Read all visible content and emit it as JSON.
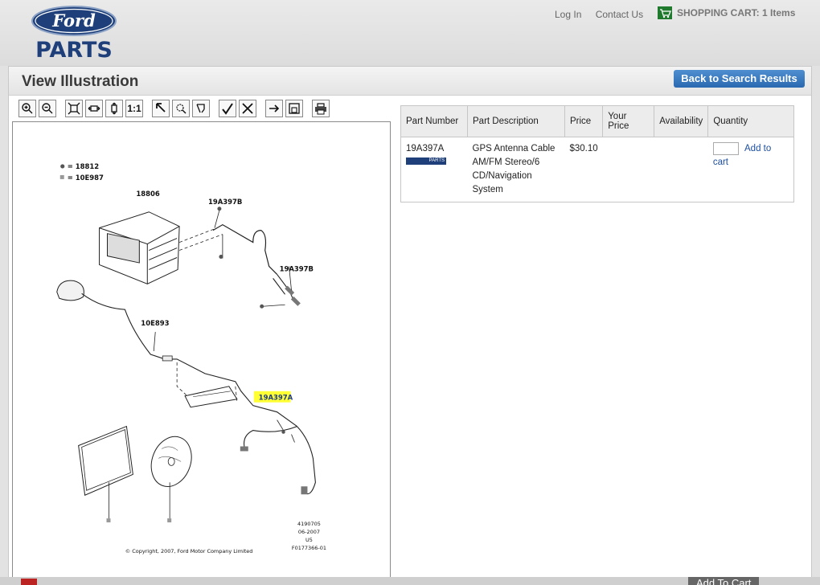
{
  "header": {
    "brand_word": "Ford",
    "parts_word": "PARTS",
    "login": "Log In",
    "contact": "Contact Us",
    "cart": "SHOPPING CART: 1 Items"
  },
  "page": {
    "title": "View Illustration",
    "back_button": "Back to Search Results"
  },
  "toolbar": {
    "buttons": [
      "zoom-in-icon",
      "zoom-out-icon",
      "fit-icon",
      "fit-width-icon",
      "fit-height-icon",
      "actual-size",
      "select-arrow-icon",
      "zoom-box-icon",
      "pan-icon",
      "check-icon",
      "clear-icon",
      "arrow-icon",
      "window-icon",
      "print-icon"
    ],
    "actual_size_label": "1:1"
  },
  "illustration": {
    "legend_dot": "= 18812",
    "legend_square": "= 10E987",
    "labels": [
      "18806",
      "19A397B",
      "19A397B",
      "10E893",
      "19A397A"
    ],
    "highlighted": "19A397A",
    "ref_lines": [
      "4190705",
      "06-2007",
      "U5",
      "F0177366-01"
    ],
    "copyright": "© Copyright, 2007, Ford Motor Company Limited"
  },
  "table": {
    "headers": [
      "Part Number",
      "Part Description",
      "Price",
      "Your Price",
      "Availability",
      "Quantity"
    ],
    "rows": [
      {
        "part_number": "19A397A",
        "badge": "PARTS",
        "desc_lines": [
          "GPS Antenna Cable",
          "AM/FM Stereo/6",
          "CD/Navigation System"
        ],
        "price": "$30.10",
        "your_price": "",
        "availability": "",
        "quantity": "",
        "add_label": "Add to cart"
      }
    ]
  },
  "footer": {
    "add_to_cart": "Add To Cart"
  },
  "colors": {
    "accent_blue": "#2a69b0",
    "highlight_yellow": "#ffff33",
    "ford_blue": "#1e3f7a"
  }
}
